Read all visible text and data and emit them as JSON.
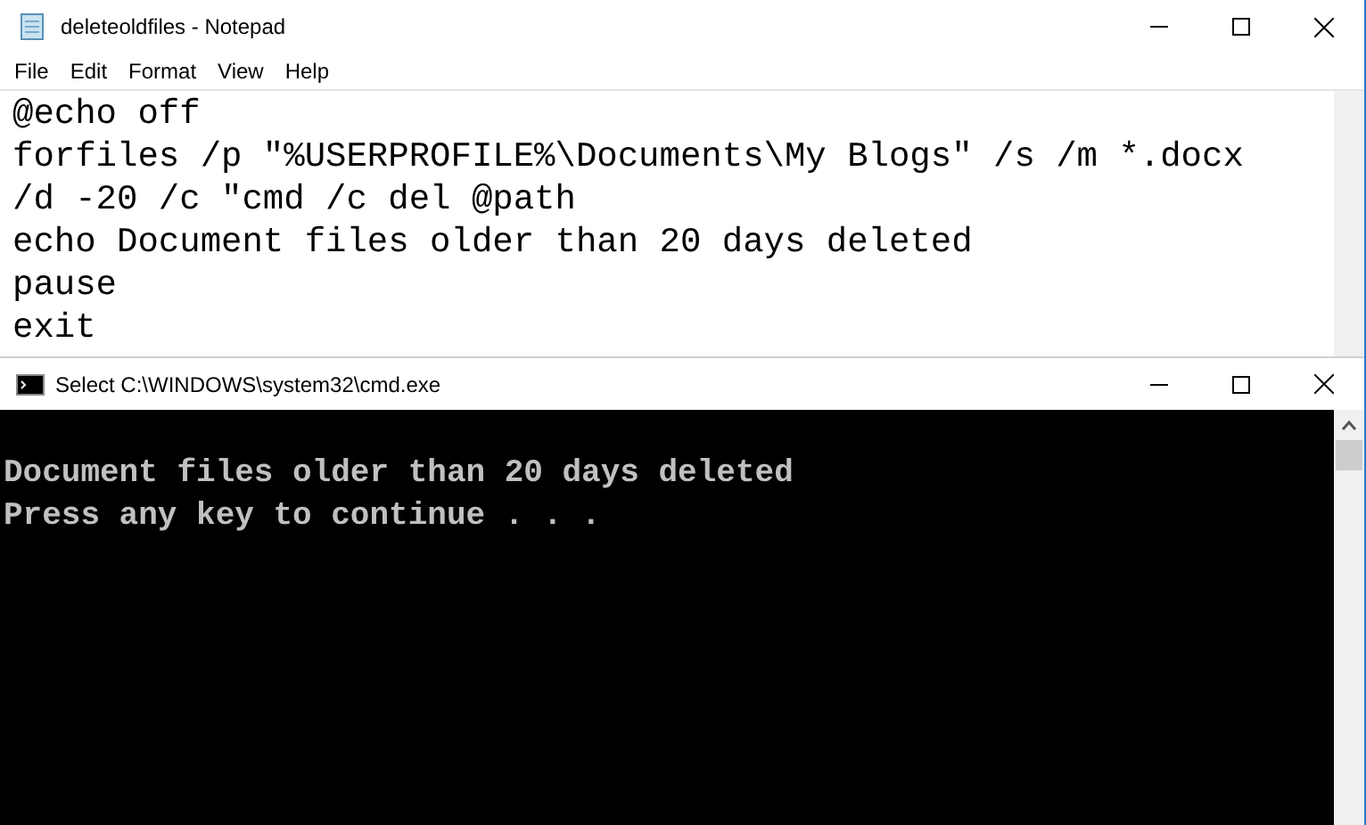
{
  "notepad": {
    "title": "deleteoldfiles - Notepad",
    "menu": [
      "File",
      "Edit",
      "Format",
      "View",
      "Help"
    ],
    "lines": [
      "@echo off",
      "forfiles /p \"%USERPROFILE%\\Documents\\My Blogs\" /s /m *.docx",
      "/d -20 /c \"cmd /c del @path",
      "echo Document files older than 20 days deleted",
      "pause",
      "exit"
    ]
  },
  "console": {
    "title": "Select C:\\WINDOWS\\system32\\cmd.exe",
    "lines": [
      "Document files older than 20 days deleted",
      "Press any key to continue . . ."
    ]
  }
}
